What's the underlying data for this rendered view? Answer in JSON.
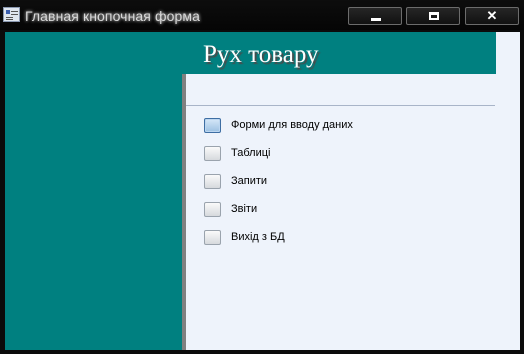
{
  "window": {
    "title": "Главная кнопочная форма",
    "controls": {
      "minimize": "minimize",
      "maximize": "maximize",
      "close": "✕"
    }
  },
  "form": {
    "header": "Рух товару",
    "items": [
      {
        "label": "Форми для вводу даних",
        "active": true
      },
      {
        "label": "Таблиці",
        "active": false
      },
      {
        "label": "Запити",
        "active": false
      },
      {
        "label": "Звіти",
        "active": false
      },
      {
        "label": "Вихід з БД",
        "active": false
      }
    ]
  },
  "colors": {
    "panel": "#008080",
    "content_background": "#eef3fb",
    "header_text": "#ffffff"
  }
}
